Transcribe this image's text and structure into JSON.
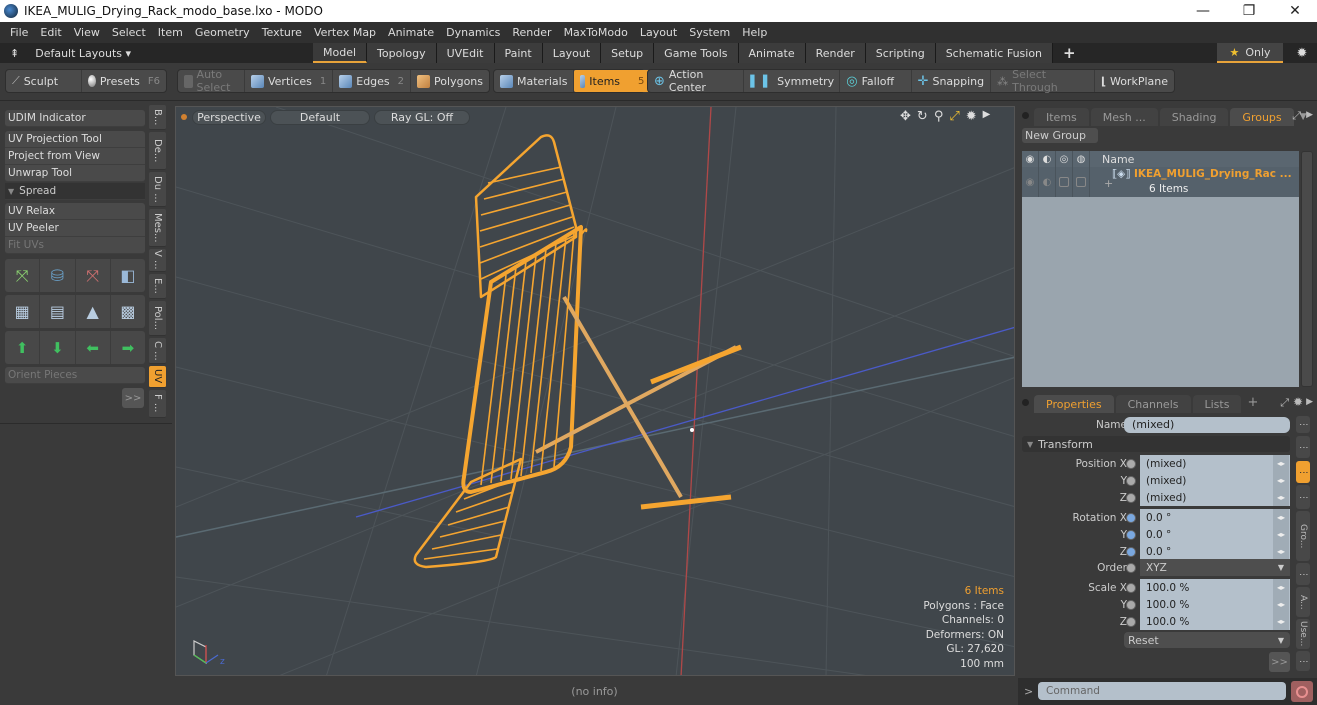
{
  "window": {
    "title": "IKEA_MULIG_Drying_Rack_modo_base.lxo - MODO",
    "minimize_icon": "minimize-icon",
    "restore_icon": "restore-icon",
    "close_icon": "close-icon"
  },
  "menu": [
    "File",
    "Edit",
    "View",
    "Select",
    "Item",
    "Geometry",
    "Texture",
    "Vertex Map",
    "Animate",
    "Dynamics",
    "Render",
    "MaxToModo",
    "Layout",
    "System",
    "Help"
  ],
  "layouts": {
    "default_label": "Default Layouts ▾",
    "tabs": [
      "Model",
      "Topology",
      "UVEdit",
      "Paint",
      "Layout",
      "Setup",
      "Game Tools",
      "Animate",
      "Render",
      "Scripting",
      "Schematic Fusion"
    ],
    "active_tab": "Model",
    "add_label": "+",
    "only_label": "Only",
    "star": "★"
  },
  "toolbar": {
    "sculpt": "Sculpt",
    "presets": "Presets",
    "presets_key": "F6",
    "auto_select": "Auto Select",
    "vertices": "Vertices",
    "vertices_key": "1",
    "edges": "Edges",
    "edges_key": "2",
    "polygons": "Polygons",
    "materials": "Materials",
    "items": "Items",
    "items_key": "5",
    "action_center": "Action Center",
    "symmetry": "Symmetry",
    "falloff": "Falloff",
    "snapping": "Snapping",
    "select_through": "Select Through",
    "workplane": "WorkPlane"
  },
  "left_panel": {
    "udim": "UDIM Indicator",
    "uv_projection": "UV Projection Tool",
    "project_from_view": "Project from View",
    "unwrap": "Unwrap Tool",
    "spread": "Spread",
    "uv_relax": "UV Relax",
    "uv_peeler": "UV Peeler",
    "fit_uvs": "Fit UVs",
    "orient_pieces": "Orient Pieces",
    "more": ">>",
    "vtabs": [
      "B...",
      "De...",
      "Du ...",
      "Mes...",
      "V ...",
      "E...",
      "Pol...",
      "C ...",
      "UV",
      "F ..."
    ],
    "active_vtab": "UV"
  },
  "viewport": {
    "view": "Perspective",
    "shading": "Default",
    "raygl": "Ray GL: Off",
    "stats": {
      "items": "6 Items",
      "polygons": "Polygons : Face",
      "channels": "Channels: 0",
      "deformers": "Deformers: ON",
      "gl": "GL: 27,620",
      "unit": "100 mm"
    },
    "accent": "#f0a030"
  },
  "status": {
    "info": "(no info)"
  },
  "groups_panel": {
    "tabs": [
      "Items",
      "Mesh ...",
      "Shading",
      "Groups"
    ],
    "active_tab": "Groups",
    "new_group": "New Group",
    "col_name": "Name",
    "group_name": "IKEA_MULIG_Drying_Rac ...",
    "group_count": "6 Items"
  },
  "properties": {
    "tabs": [
      "Properties",
      "Channels",
      "Lists"
    ],
    "active_tab": "Properties",
    "add_tab": "+",
    "name_label": "Name",
    "name_value": "(mixed)",
    "transform": "Transform",
    "position": {
      "label_x": "Position X",
      "label_y": "Y",
      "label_z": "Z",
      "x": "(mixed)",
      "y": "(mixed)",
      "z": "(mixed)"
    },
    "rotation": {
      "label_x": "Rotation X",
      "label_y": "Y",
      "label_z": "Z",
      "x": "0.0 °",
      "y": "0.0 °",
      "z": "0.0 °"
    },
    "order_label": "Order",
    "order_value": "XYZ",
    "scale": {
      "label_x": "Scale X",
      "label_y": "Y",
      "label_z": "Z",
      "x": "100.0 %",
      "y": "100.0 %",
      "z": "100.0 %"
    },
    "reset": "Reset",
    "more": ">>",
    "side_tabs": [
      "Gro...",
      "A...",
      "Use..."
    ]
  },
  "command": {
    "prompt": ">",
    "placeholder": "Command"
  }
}
